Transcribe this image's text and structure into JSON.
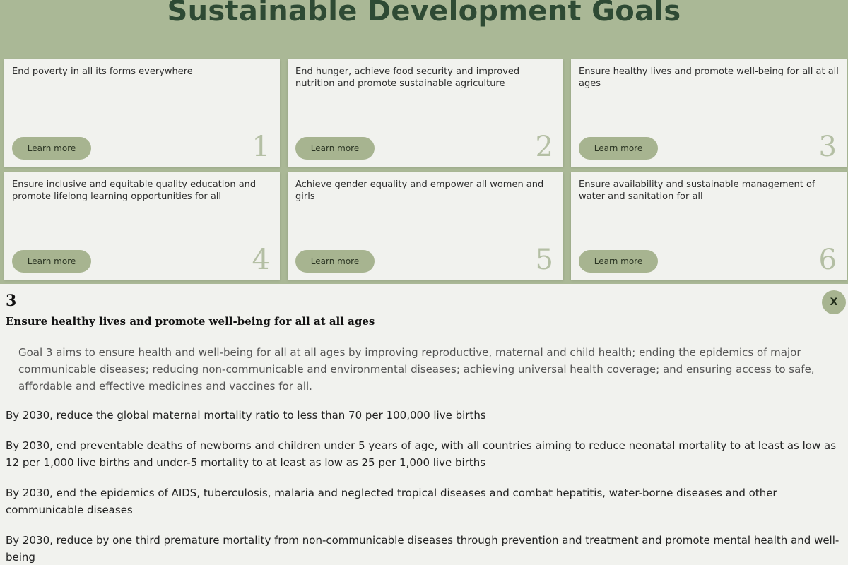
{
  "header": {
    "title": "Sustainable Development Goals"
  },
  "goals": [
    {
      "number": "1",
      "text": "End poverty in all its forms everywhere",
      "button_label": "Learn more"
    },
    {
      "number": "2",
      "text": "End hunger, achieve food security and improved nutrition and promote sustainable agriculture",
      "button_label": "Learn more"
    },
    {
      "number": "3",
      "text": "Ensure healthy lives and promote well-being for all at all ages",
      "button_label": "Learn more"
    },
    {
      "number": "4",
      "text": "Ensure inclusive and equitable quality education and promote lifelong learning opportunities for all",
      "button_label": "Learn more"
    },
    {
      "number": "5",
      "text": "Achieve gender equality and empower all women and girls",
      "button_label": "Learn more"
    },
    {
      "number": "6",
      "text": "Ensure availability and sustainable management of water and sanitation for all",
      "button_label": "Learn more"
    }
  ],
  "detail": {
    "number": "3",
    "heading": "Ensure healthy lives and promote well-being for all at all ages",
    "close_label": "X",
    "summary": "Goal 3 aims to ensure health and well-being for all at all ages by improving reproductive, maternal and child health; ending the epidemics of major communicable diseases; reducing non-communicable and environmental diseases; achieving universal health coverage; and ensuring access to safe, affordable and effective medicines and vaccines for all.",
    "targets": [
      "By 2030, reduce the global maternal mortality ratio to less than 70 per 100,000 live births",
      "By 2030, end preventable deaths of newborns and children under 5 years of age, with all countries aiming to reduce neonatal mortality to at least as low as 12 per 1,000 live births and under-5 mortality to at least as low as 25 per 1,000 live births",
      "By 2030, end the epidemics of AIDS, tuberculosis, malaria and neglected tropical diseases and combat hepatitis, water-borne diseases and other communicable diseases",
      "By 2030, reduce by one third premature mortality from non-communicable diseases through prevention and treatment and promote mental health and well-being"
    ]
  },
  "colors": {
    "background": "#aab896",
    "title": "#2e4a34",
    "card": "#f1f2ee",
    "button": "#a7b490",
    "number": "#b4bfa4"
  }
}
